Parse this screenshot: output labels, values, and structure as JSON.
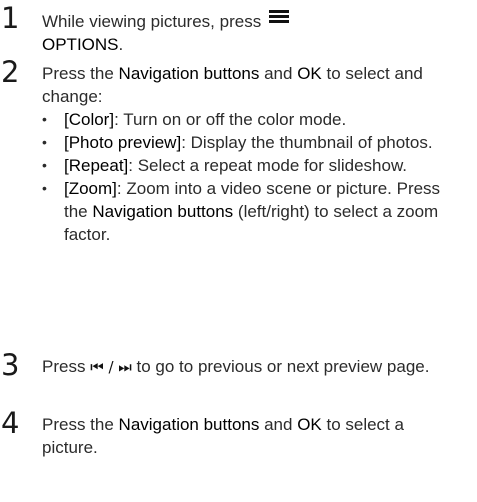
{
  "steps": [
    {
      "number": "1",
      "text_before": "While viewing pictures, press ",
      "bold": "OPTIONS",
      "text_after": "."
    },
    {
      "number": "2",
      "intro_a": "Press the ",
      "intro_bold_1": "Navigation buttons",
      "intro_b": " and ",
      "intro_bold_2": "OK",
      "intro_c": " to select and change:",
      "options": [
        {
          "label": "[Color]",
          "desc": ": Turn on or off the color mode."
        },
        {
          "label": "[Photo preview]",
          "desc": ": Display the thumbnail of photos."
        },
        {
          "label": "[Repeat]",
          "desc": ": Select a repeat mode for slideshow."
        },
        {
          "label": "[Zoom]",
          "desc_a": ": Zoom into a video scene or picture. Press the ",
          "desc_bold": "Navigation buttons",
          "desc_b": " (left/right) to select a zoom factor."
        }
      ]
    },
    {
      "number": "3",
      "text_a": "Press ",
      "symbols": "⏮ / ⏭",
      "text_b": " to go to previous or next preview page."
    },
    {
      "number": "4",
      "text_a": "Press the ",
      "bold_1": "Navigation buttons",
      "text_b": " and ",
      "bold_2": "OK",
      "text_c": " to select a picture."
    }
  ],
  "bullet_char": "•"
}
